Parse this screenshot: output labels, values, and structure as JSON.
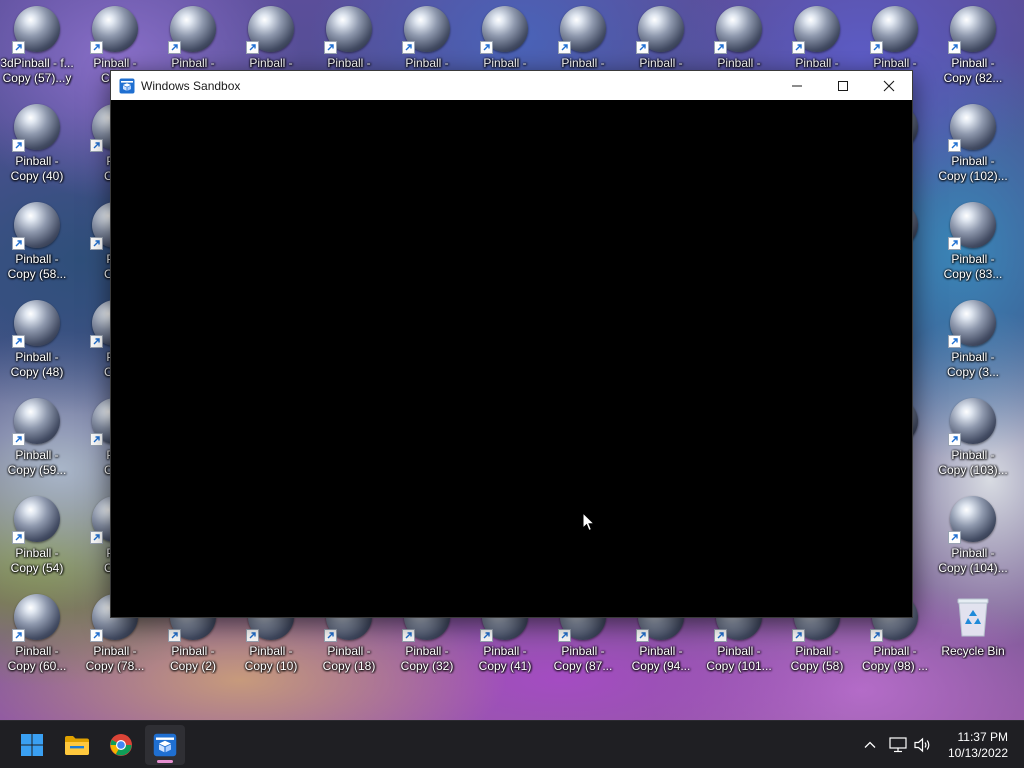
{
  "desktop": {
    "icons": [
      {
        "label": "3dPinball - f...\nCopy (57)...y",
        "col": 0,
        "row": 0,
        "type": "pinball"
      },
      {
        "label": "Pinball -\nCopy",
        "col": 1,
        "row": 0,
        "type": "pinball"
      },
      {
        "label": "Pinball -",
        "col": 2,
        "row": 0,
        "type": "pinball"
      },
      {
        "label": "Pinball -",
        "col": 3,
        "row": 0,
        "type": "pinball"
      },
      {
        "label": "Pinball -",
        "col": 4,
        "row": 0,
        "type": "pinball"
      },
      {
        "label": "Pinball -",
        "col": 5,
        "row": 0,
        "type": "pinball"
      },
      {
        "label": "Pinball -",
        "col": 6,
        "row": 0,
        "type": "pinball"
      },
      {
        "label": "Pinball -",
        "col": 7,
        "row": 0,
        "type": "pinball"
      },
      {
        "label": "Pinball -",
        "col": 8,
        "row": 0,
        "type": "pinball"
      },
      {
        "label": "Pinball -",
        "col": 9,
        "row": 0,
        "type": "pinball"
      },
      {
        "label": "Pinball -",
        "col": 10,
        "row": 0,
        "type": "pinball"
      },
      {
        "label": "Pinball -",
        "col": 11,
        "row": 0,
        "type": "pinball"
      },
      {
        "label": "Pinball -\nCopy (82...",
        "col": 12,
        "row": 0,
        "type": "pinball"
      },
      {
        "label": "Pinball -\nCopy (40)",
        "col": 0,
        "row": 1,
        "type": "pinball"
      },
      {
        "label": "Pin\nCop",
        "col": 1,
        "row": 1,
        "type": "pinball"
      },
      {
        "label": "5)",
        "col": 11,
        "row": 1,
        "type": "pinball"
      },
      {
        "label": "Pinball -\nCopy (102)...",
        "col": 12,
        "row": 1,
        "type": "pinball"
      },
      {
        "label": "Pinball -\nCopy (58...",
        "col": 0,
        "row": 2,
        "type": "pinball"
      },
      {
        "label": "Pin\nCop",
        "col": 1,
        "row": 2,
        "type": "pinball"
      },
      {
        "label": ")\n...",
        "col": 11,
        "row": 2,
        "type": "pinball"
      },
      {
        "label": "Pinball -\nCopy (83...",
        "col": 12,
        "row": 2,
        "type": "pinball"
      },
      {
        "label": "Pinball -\nCopy (48)",
        "col": 0,
        "row": 3,
        "type": "pinball"
      },
      {
        "label": "Pin\nCop",
        "col": 1,
        "row": 3,
        "type": "pinball"
      },
      {
        "label": "Pinball -\nCopy (3...",
        "col": 12,
        "row": 3,
        "type": "pinball"
      },
      {
        "label": "Pinball -\nCopy (59...",
        "col": 0,
        "row": 4,
        "type": "pinball"
      },
      {
        "label": "Pin\nCop",
        "col": 1,
        "row": 4,
        "type": "pinball"
      },
      {
        "label": ")\n...",
        "col": 11,
        "row": 4,
        "type": "pinball"
      },
      {
        "label": "Pinball -\nCopy (103)...",
        "col": 12,
        "row": 4,
        "type": "pinball"
      },
      {
        "label": "Pinball -\nCopy (54)",
        "col": 0,
        "row": 5,
        "type": "pinball"
      },
      {
        "label": "Pin\nCop",
        "col": 1,
        "row": 5,
        "type": "pinball"
      },
      {
        "label": "Pinball -\nCopy (104)...",
        "col": 12,
        "row": 5,
        "type": "pinball"
      },
      {
        "label": "Pinball -\nCopy (60...",
        "col": 0,
        "row": 6,
        "type": "pinball"
      },
      {
        "label": "Pinball -\nCopy (78...",
        "col": 1,
        "row": 6,
        "type": "pinball"
      },
      {
        "label": "Pinball -\nCopy (2)",
        "col": 2,
        "row": 6,
        "type": "pinball"
      },
      {
        "label": "Pinball -\nCopy (10)",
        "col": 3,
        "row": 6,
        "type": "pinball"
      },
      {
        "label": "Pinball -\nCopy (18)",
        "col": 4,
        "row": 6,
        "type": "pinball"
      },
      {
        "label": "Pinball -\nCopy (32)",
        "col": 5,
        "row": 6,
        "type": "pinball"
      },
      {
        "label": "Pinball -\nCopy (41)",
        "col": 6,
        "row": 6,
        "type": "pinball"
      },
      {
        "label": "Pinball -\nCopy (87...",
        "col": 7,
        "row": 6,
        "type": "pinball"
      },
      {
        "label": "Pinball -\nCopy (94...",
        "col": 8,
        "row": 6,
        "type": "pinball"
      },
      {
        "label": "Pinball -\nCopy (101...",
        "col": 9,
        "row": 6,
        "type": "pinball"
      },
      {
        "label": "Pinball -\nCopy (58)",
        "col": 10,
        "row": 6,
        "type": "pinball"
      },
      {
        "label": "Pinball -\nCopy (98) ...",
        "col": 11,
        "row": 6,
        "type": "pinball"
      },
      {
        "label": "Recycle Bin",
        "col": 12,
        "row": 6,
        "type": "recycle"
      }
    ]
  },
  "window": {
    "title": "Windows Sandbox",
    "icon": "sandbox-icon",
    "controls": [
      "minimize-icon",
      "maximize-icon",
      "close-icon"
    ]
  },
  "taskbar": {
    "apps": [
      {
        "name": "start-button",
        "icon": "windows-logo-icon",
        "active": false
      },
      {
        "name": "file-explorer-button",
        "icon": "folder-icon",
        "active": false
      },
      {
        "name": "chrome-button",
        "icon": "chrome-icon",
        "active": false
      },
      {
        "name": "windows-sandbox-button",
        "icon": "sandbox-icon",
        "active": true
      }
    ],
    "tray": {
      "icons": [
        "chevron-up-icon",
        "network-icon",
        "volume-icon"
      ],
      "time": "11:37 PM",
      "date": "10/13/2022"
    }
  },
  "colors": {
    "taskbar_bg": "#1f1f23",
    "window_body": "#000000",
    "titlebar_bg": "#ffffff",
    "active_indicator": "#e58fd0",
    "sandbox_blue": "#1f6fd1"
  }
}
